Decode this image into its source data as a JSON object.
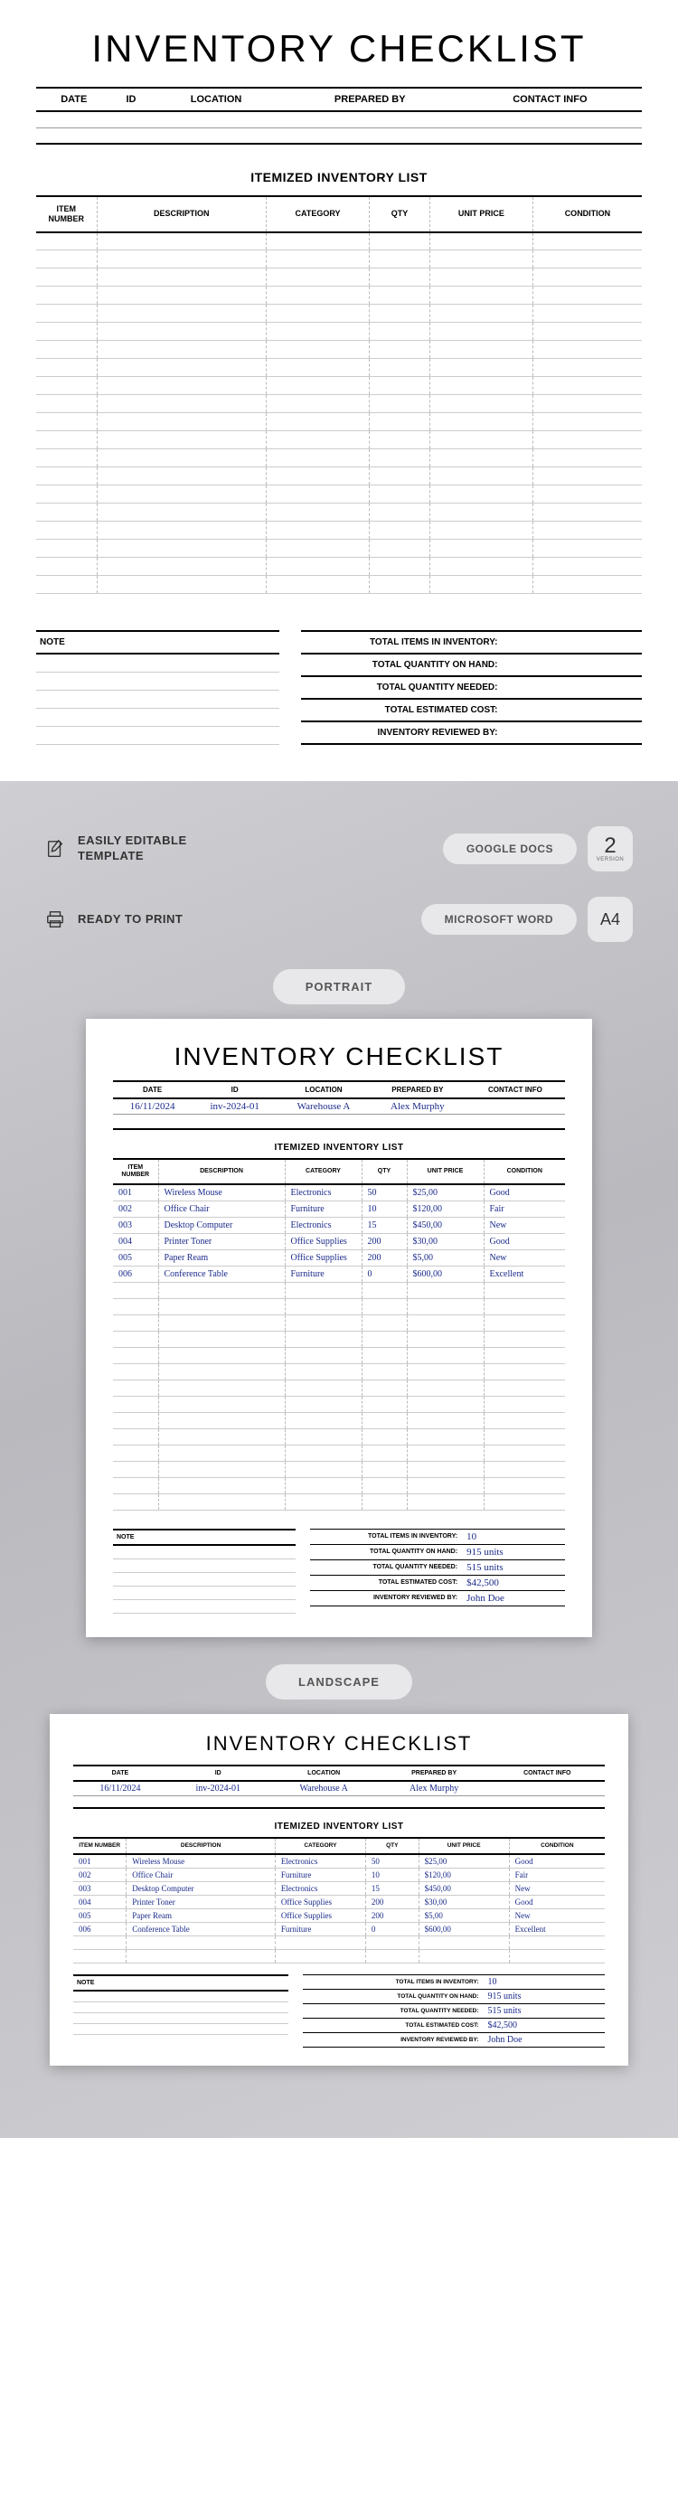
{
  "blank": {
    "title": "INVENTORY CHECKLIST",
    "meta_headers": [
      "DATE",
      "ID",
      "LOCATION",
      "PREPARED BY",
      "CONTACT INFO"
    ],
    "subtitle": "ITEMIZED INVENTORY LIST",
    "item_headers": [
      "ITEM NUMBER",
      "DESCRIPTION",
      "CATEGORY",
      "QTY",
      "UNIT PRICE",
      "CONDITION"
    ],
    "blank_rows": 20,
    "note_label": "NOTE",
    "note_lines": 5,
    "totals_labels": [
      "TOTAL ITEMS IN INVENTORY:",
      "TOTAL QUANTITY ON HAND:",
      "TOTAL QUANTITY NEEDED:",
      "TOTAL ESTIMATED COST:",
      "INVENTORY REVIEWED BY:"
    ]
  },
  "promo": {
    "feature1": "EASILY EDITABLE\nTEMPLATE",
    "feature2": "READY TO PRINT",
    "pill1": "GOOGLE DOCS",
    "pill2": "MICROSOFT WORD",
    "badge1_top": "2",
    "badge1_bottom": "VERSION",
    "badge2": "A4",
    "orient1": "PORTRAIT",
    "orient2": "LANDSCAPE"
  },
  "filled": {
    "meta": {
      "date": "16/11/2024",
      "id": "inv-2024-01",
      "location": "Warehouse A",
      "prepared_by": "Alex Murphy",
      "contact": ""
    },
    "items": [
      {
        "num": "001",
        "desc": "Wireless Mouse",
        "cat": "Electronics",
        "qty": "50",
        "price": "$25,00",
        "cond": "Good"
      },
      {
        "num": "002",
        "desc": "Office Chair",
        "cat": "Furniture",
        "qty": "10",
        "price": "$120,00",
        "cond": "Fair"
      },
      {
        "num": "003",
        "desc": "Desktop Computer",
        "cat": "Electronics",
        "qty": "15",
        "price": "$450,00",
        "cond": "New"
      },
      {
        "num": "004",
        "desc": "Printer Toner",
        "cat": "Office Supplies",
        "qty": "200",
        "price": "$30,00",
        "cond": "Good"
      },
      {
        "num": "005",
        "desc": "Paper Ream",
        "cat": "Office Supplies",
        "qty": "200",
        "price": "$5,00",
        "cond": "New"
      },
      {
        "num": "006",
        "desc": "Conference Table",
        "cat": "Furniture",
        "qty": "0",
        "price": "$600,00",
        "cond": "Excellent"
      }
    ],
    "portrait_blank_rows": 14,
    "landscape_blank_rows": 2,
    "totals": {
      "items": "10",
      "on_hand": "915 units",
      "needed": "515 units",
      "cost": "$42,500",
      "reviewed": "John Doe"
    }
  }
}
